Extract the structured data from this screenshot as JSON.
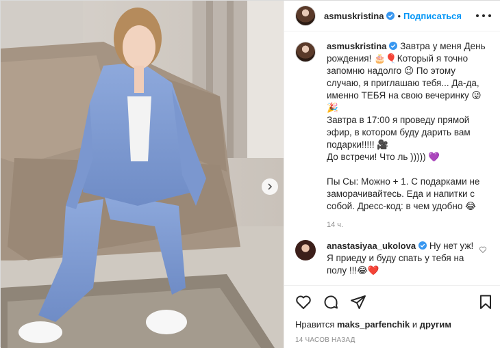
{
  "header": {
    "username": "asmuskristina",
    "separator": "•",
    "follow_label": "Подписаться"
  },
  "caption": {
    "username": "asmuskristina",
    "paragraphs": [
      "Завтра у меня День рождения! 🎂🎈Который я точно запомню надолго 😉 По этому случаю, я приглашаю тебя... Да-да, именно ТЕБЯ на свою вечеринку 😜 🎉",
      "Завтра в 17:00 я проведу прямой эфир, в котором буду дарить вам подарки!!!!! 🎥",
      "До встречи! Что ль ))))) 💜",
      "",
      "Пы Сы: Можно + 1. С подарками не заморачивайтесь. Еда и напитки с собой. Дресс-код: в чем удобно 😂"
    ],
    "time": "14 ч."
  },
  "comment": {
    "username": "anastasiyaa_ukolova",
    "text": "Ну нет уж! Я приеду и буду спать у тебя на полу !!!😂❤️"
  },
  "likes": {
    "prefix": "Нравится",
    "user": "maks_parfenchik",
    "and": "и",
    "others": "другим"
  },
  "timestamp": "14 ЧАСОВ НАЗАД",
  "icons": [
    "heart-icon",
    "comment-icon",
    "share-icon",
    "bookmark-icon",
    "more-icon",
    "chevron-right-icon",
    "verified-icon"
  ],
  "colors": {
    "follow": "#0095f6",
    "verified": "#3897f0",
    "muted": "#8e8e8e"
  }
}
